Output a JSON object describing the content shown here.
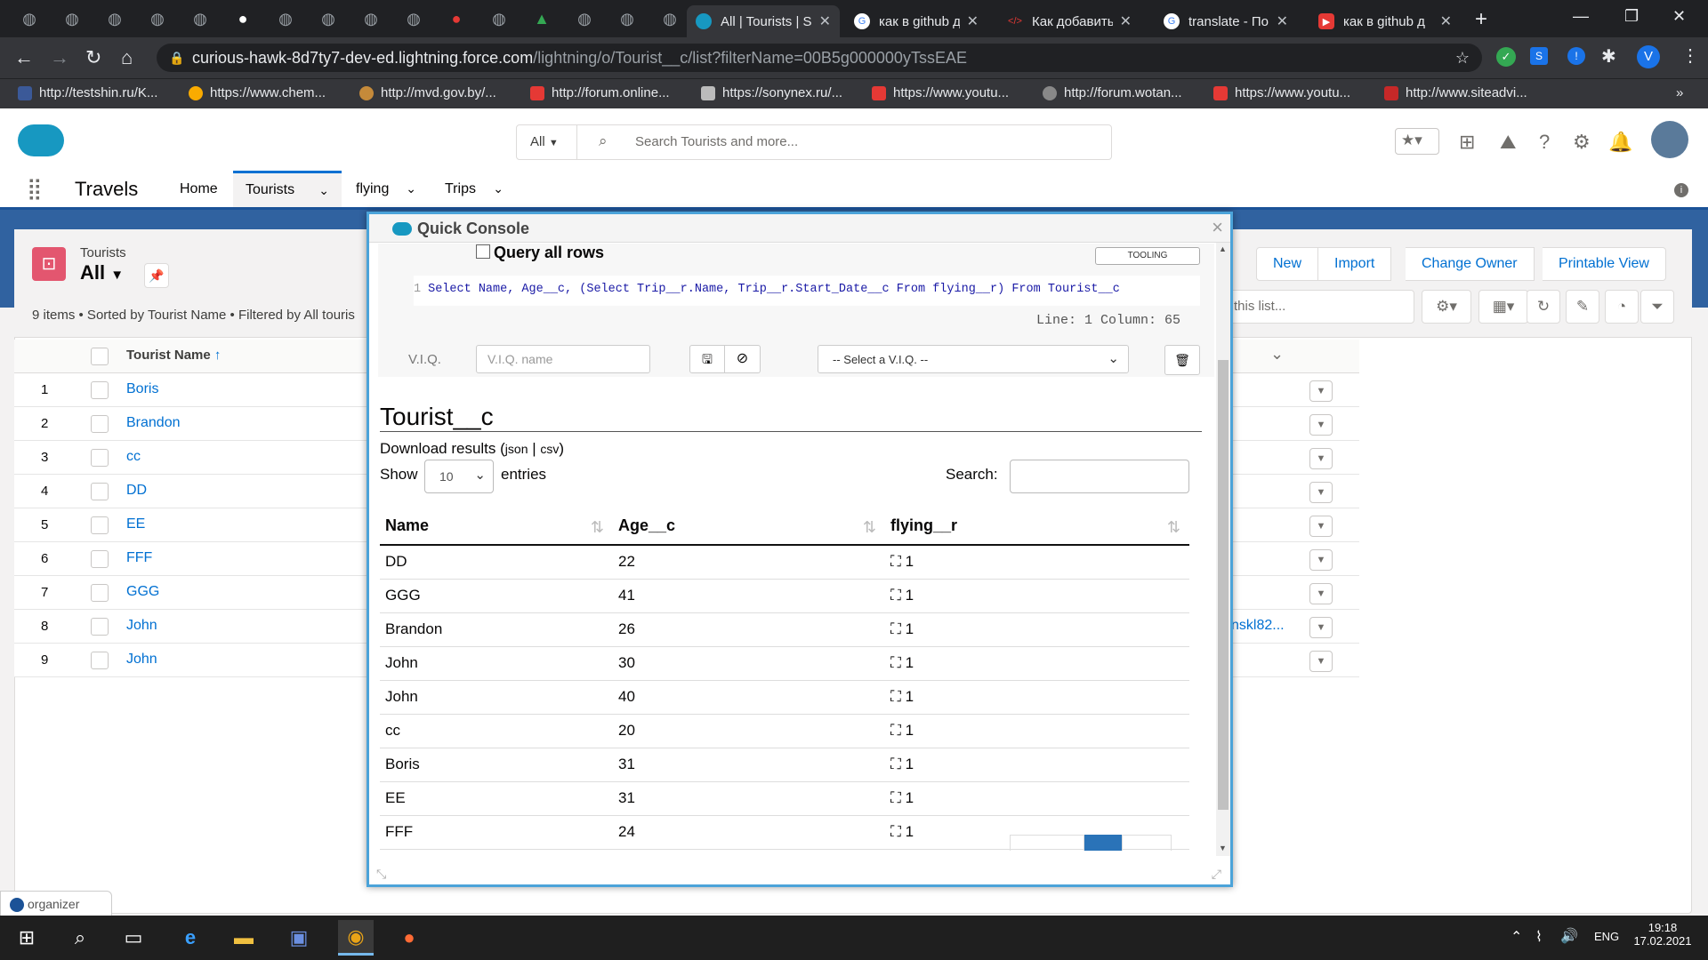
{
  "browser": {
    "tabs": [
      {
        "title": "All | Tourists | S",
        "active": true,
        "icon": "salesforce-icon"
      },
      {
        "title": "как в github д",
        "icon": "google-icon"
      },
      {
        "title": "Как добавить",
        "icon": "code-icon"
      },
      {
        "title": "translate - По",
        "icon": "google-icon"
      },
      {
        "title": "как в github д",
        "icon": "youtube-icon"
      }
    ],
    "url_host": "curious-hawk-8d7ty7-dev-ed.lightning.force.com",
    "url_path": "/lightning/o/Tourist__c/list?filterName=00B5g000000yTssEAE",
    "profile_initial": "V",
    "bookmarks": [
      "http://testshin.ru/K...",
      "https://www.chem...",
      "http://mvd.gov.by/...",
      "http://forum.online...",
      "https://sonynex.ru/...",
      "https://www.youtu...",
      "http://forum.wotan...",
      "https://www.youtu...",
      "http://www.siteadvi..."
    ],
    "more": "»"
  },
  "sf": {
    "search_scope": "All",
    "search_placeholder": "Search Tourists and more...",
    "app_name": "Travels",
    "nav": [
      "Home",
      "Tourists",
      "flying",
      "Trips"
    ],
    "object_label": "Tourists",
    "list_view": "All",
    "list_meta": "9 items • Sorted by Tourist Name • Filtered by All touris",
    "buttons": [
      "New",
      "Import",
      "Change Owner",
      "Printable View"
    ],
    "search_list_placeholder": "this list...",
    "column_header": "Tourist Name",
    "rows": [
      {
        "n": "1",
        "name": "Boris"
      },
      {
        "n": "2",
        "name": "Brandon"
      },
      {
        "n": "3",
        "name": "cc"
      },
      {
        "n": "4",
        "name": "DD"
      },
      {
        "n": "5",
        "name": "EE"
      },
      {
        "n": "6",
        "name": "FFF"
      },
      {
        "n": "7",
        "name": "GGG"
      },
      {
        "n": "8",
        "name": "John"
      },
      {
        "n": "9",
        "name": "John"
      }
    ],
    "row8_extra": "nskl82...",
    "organizer": "organizer"
  },
  "console": {
    "title": "Quick Console",
    "query_all_rows": "Query all rows",
    "tooling": "TOOLING",
    "line_no": "1",
    "query": "Select Name, Age__c, (Select Trip__r.Name, Trip__r.Start_Date__c From flying__r) From Tourist__c",
    "cursor": "Line: 1 Column: 65",
    "viq_label": "V.I.Q.",
    "viq_placeholder": "V.I.Q. name",
    "viq_select": "-- Select a V.I.Q. --",
    "result_object": "Tourist__c",
    "download_label": "Download results",
    "download_json": "json",
    "download_csv": "csv",
    "show_label": "Show",
    "show_value": "10",
    "entries_label": "entries",
    "search_label": "Search:",
    "columns": [
      "Name",
      "Age__c",
      "flying__r"
    ],
    "results": [
      {
        "name": "DD",
        "age": "22",
        "flying": "1"
      },
      {
        "name": "GGG",
        "age": "41",
        "flying": "1"
      },
      {
        "name": "Brandon",
        "age": "26",
        "flying": "1"
      },
      {
        "name": "John",
        "age": "30",
        "flying": "1"
      },
      {
        "name": "John",
        "age": "40",
        "flying": "1"
      },
      {
        "name": "cc",
        "age": "20",
        "flying": "1"
      },
      {
        "name": "Boris",
        "age": "31",
        "flying": "1"
      },
      {
        "name": "EE",
        "age": "31",
        "flying": "1"
      },
      {
        "name": "FFF",
        "age": "24",
        "flying": "1"
      }
    ]
  },
  "taskbar": {
    "lang": "ENG",
    "time": "19:18",
    "date": "17.02.2021"
  }
}
